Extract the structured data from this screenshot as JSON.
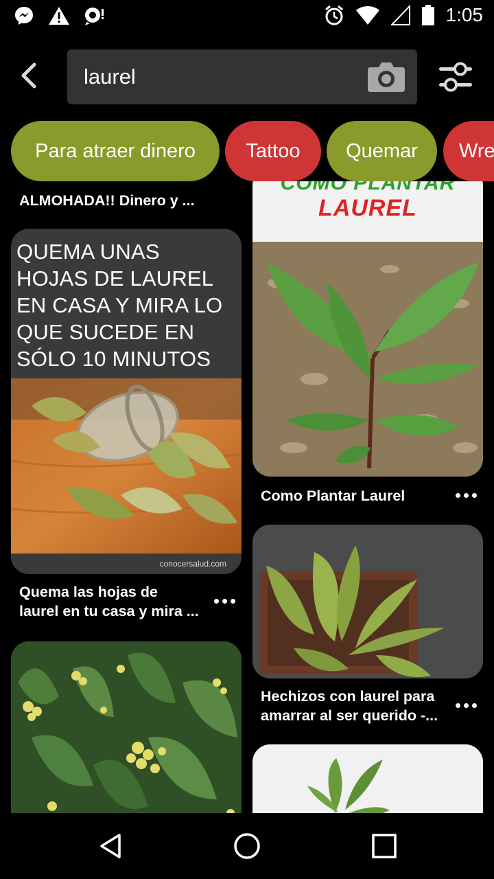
{
  "status_bar": {
    "time": "1:05",
    "left_icons": [
      "messenger-icon",
      "warning-icon",
      "chat-notification-icon"
    ],
    "right_icons": [
      "alarm-icon",
      "wifi-icon",
      "cell-signal-icon",
      "battery-icon"
    ]
  },
  "search": {
    "query": "laurel"
  },
  "chips": [
    {
      "label": "Para atraer dinero",
      "color": "#8a9a2b"
    },
    {
      "label": "Tattoo",
      "color": "#d03535"
    },
    {
      "label": "Quemar",
      "color": "#8a9a2b"
    },
    {
      "label": "Wre",
      "color": "#d03535"
    }
  ],
  "feed": {
    "left": [
      {
        "caption": "ALMOHADA!! Dinero y ..."
      },
      {
        "image_text": [
          "QUEMA UNAS",
          "HOJAS DE LAUREL",
          "EN CASA Y MIRA LO",
          "QUE SUCEDE EN",
          "SÓLO 10 MINUTOS"
        ],
        "watermark": "conocersalud.com",
        "caption": [
          "Quema las hojas de",
          "laurel en tu casa y mira ..."
        ]
      },
      {
        "caption": ""
      }
    ],
    "right": [
      {
        "image_text": [
          "COMO PLANTAR",
          "LAUREL"
        ],
        "caption": "Como Plantar Laurel"
      },
      {
        "caption": [
          "Hechizos con laurel para",
          "amarrar al ser querido -..."
        ]
      },
      {
        "caption": ""
      }
    ]
  },
  "colors": {
    "background": "#000000",
    "search_box": "#333333",
    "chip_olive": "#8a9a2b",
    "chip_red": "#d03535"
  }
}
